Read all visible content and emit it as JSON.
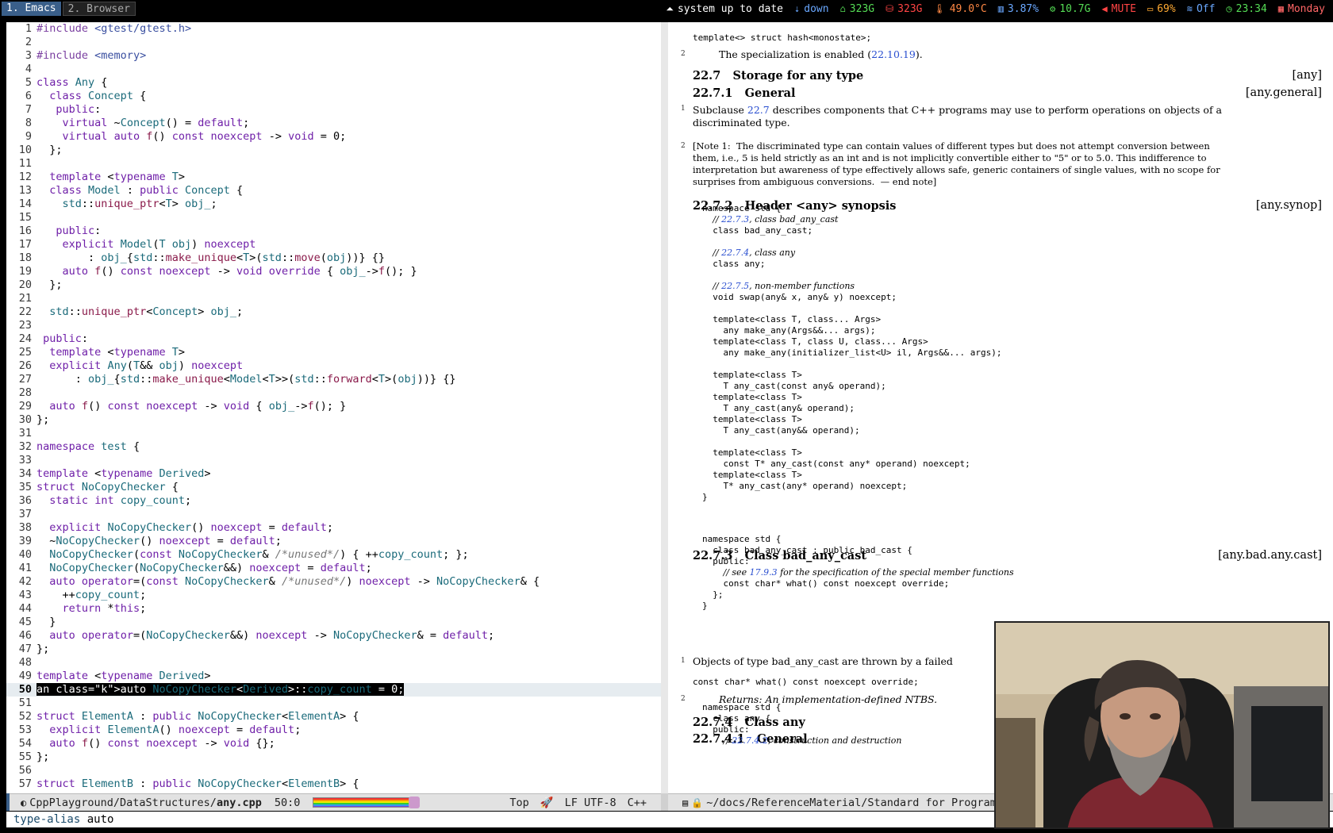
{
  "topbar": {
    "workspaces": [
      {
        "label": "1. Emacs"
      },
      {
        "label": "2. Browser"
      }
    ],
    "status": [
      {
        "icon": "arch-icon",
        "label": "system up to date",
        "color": "#ffffff"
      },
      {
        "icon": "network-icon",
        "label": "down",
        "color": "#6aa8ff"
      },
      {
        "icon": "home-disk-icon",
        "label": "323G",
        "color": "#55dd55"
      },
      {
        "icon": "root-disk-icon",
        "label": "323G",
        "color": "#ff4444"
      },
      {
        "icon": "temperature-icon",
        "label": "49.0°C",
        "color": "#ff8844"
      },
      {
        "icon": "cpu-icon",
        "label": "3.87%",
        "color": "#6aa8ff"
      },
      {
        "icon": "memory-icon",
        "label": "10.7G",
        "color": "#55dd55"
      },
      {
        "icon": "volume-icon",
        "label": "MUTE",
        "color": "#ff4444"
      },
      {
        "icon": "battery-icon",
        "label": "69%",
        "color": "#ffaa33"
      },
      {
        "icon": "wifi-icon",
        "label": "Off",
        "color": "#6aa8ff"
      },
      {
        "icon": "clock-icon",
        "label": "23:34",
        "color": "#55dd55"
      },
      {
        "icon": "calendar-icon",
        "label": "Monday",
        "color": "#ff6666"
      }
    ]
  },
  "editor": {
    "lines": [
      {
        "n": "1",
        "t": "#include <gtest/gtest.h>"
      },
      {
        "n": "2",
        "t": ""
      },
      {
        "n": "3",
        "t": "#include <memory>"
      },
      {
        "n": "4",
        "t": ""
      },
      {
        "n": "5",
        "t": "class Any {"
      },
      {
        "n": "6",
        "t": "  class Concept {"
      },
      {
        "n": "7",
        "t": "   public:"
      },
      {
        "n": "8",
        "t": "    virtual ~Concept() = default;"
      },
      {
        "n": "9",
        "t": "    virtual auto f() const noexcept -> void = 0;"
      },
      {
        "n": "10",
        "t": "  };"
      },
      {
        "n": "11",
        "t": ""
      },
      {
        "n": "12",
        "t": "  template <typename T>"
      },
      {
        "n": "13",
        "t": "  class Model : public Concept {"
      },
      {
        "n": "14",
        "t": "    std::unique_ptr<T> obj_;"
      },
      {
        "n": "15",
        "t": ""
      },
      {
        "n": "16",
        "t": "   public:"
      },
      {
        "n": "17",
        "t": "    explicit Model(T obj) noexcept"
      },
      {
        "n": "18",
        "t": "        : obj_{std::make_unique<T>(std::move(obj))} {}"
      },
      {
        "n": "19",
        "t": "    auto f() const noexcept -> void override { obj_->f(); }"
      },
      {
        "n": "20",
        "t": "  };"
      },
      {
        "n": "21",
        "t": ""
      },
      {
        "n": "22",
        "t": "  std::unique_ptr<Concept> obj_;"
      },
      {
        "n": "23",
        "t": ""
      },
      {
        "n": "24",
        "t": " public:"
      },
      {
        "n": "25",
        "t": "  template <typename T>"
      },
      {
        "n": "26",
        "t": "  explicit Any(T&& obj) noexcept"
      },
      {
        "n": "27",
        "t": "      : obj_{std::make_unique<Model<T>>(std::forward<T>(obj))} {}"
      },
      {
        "n": "28",
        "t": ""
      },
      {
        "n": "29",
        "t": "  auto f() const noexcept -> void { obj_->f(); }"
      },
      {
        "n": "30",
        "t": "};"
      },
      {
        "n": "31",
        "t": ""
      },
      {
        "n": "32",
        "t": "namespace test {"
      },
      {
        "n": "33",
        "t": ""
      },
      {
        "n": "34",
        "t": "template <typename Derived>"
      },
      {
        "n": "35",
        "t": "struct NoCopyChecker {"
      },
      {
        "n": "36",
        "t": "  static int copy_count;"
      },
      {
        "n": "37",
        "t": ""
      },
      {
        "n": "38",
        "t": "  explicit NoCopyChecker() noexcept = default;"
      },
      {
        "n": "39",
        "t": "  ~NoCopyChecker() noexcept = default;"
      },
      {
        "n": "40",
        "t": "  NoCopyChecker(const NoCopyChecker& /*unused*/) { ++copy_count; };"
      },
      {
        "n": "41",
        "t": "  NoCopyChecker(NoCopyChecker&&) noexcept = default;"
      },
      {
        "n": "42",
        "t": "  auto operator=(const NoCopyChecker& /*unused*/) noexcept -> NoCopyChecker& {"
      },
      {
        "n": "43",
        "t": "    ++copy_count;"
      },
      {
        "n": "44",
        "t": "    return *this;"
      },
      {
        "n": "45",
        "t": "  }"
      },
      {
        "n": "46",
        "t": "  auto operator=(NoCopyChecker&&) noexcept -> NoCopyChecker& = default;"
      },
      {
        "n": "47",
        "t": "};"
      },
      {
        "n": "48",
        "t": ""
      },
      {
        "n": "49",
        "t": "template <typename Derived>"
      },
      {
        "n": "50",
        "t": "auto NoCopyChecker<Derived>::copy_count = 0;"
      },
      {
        "n": "51",
        "t": ""
      },
      {
        "n": "52",
        "t": "struct ElementA : public NoCopyChecker<ElementA> {"
      },
      {
        "n": "53",
        "t": "  explicit ElementA() noexcept = default;"
      },
      {
        "n": "54",
        "t": "  auto f() const noexcept -> void {};"
      },
      {
        "n": "55",
        "t": "};"
      },
      {
        "n": "56",
        "t": ""
      },
      {
        "n": "57",
        "t": "struct ElementB : public NoCopyChecker<ElementB> {"
      }
    ],
    "current_line": "50"
  },
  "doc": {
    "top_code": "template<> struct hash<monostate>;",
    "p2_num": "2",
    "p2_text": "The specialization is enabled (",
    "p2_link": "22.10.19",
    "p2_end": ").",
    "s227_num": "22.7",
    "s227_title": "Storage for any type",
    "s227_tag": "[any]",
    "s2271_num": "22.7.1",
    "s2271_title": "General",
    "s2271_tag": "[any.general]",
    "gen1_num": "1",
    "gen1_a": "Subclause ",
    "gen1_link": "22.7",
    "gen1_b": " describes components that C++ programs may use to perform operations on objects of a",
    "gen1_c": "discriminated type.",
    "gen2_num": "2",
    "gen2_l1": "[Note 1:  The discriminated type can contain values of different types but does not attempt conversion between",
    "gen2_l2": "them, i.e., 5 is held strictly as an int and is not implicitly convertible either to \"5\" or to 5.0. This indifference to",
    "gen2_l3": "interpretation but awareness of type effectively allows safe, generic containers of single values, with no scope for",
    "gen2_l4": "surprises from ambiguous conversions.  — end note]",
    "s2272_num": "22.7.2",
    "s2272_title": "Header <any> synopsis",
    "s2272_tag": "[any.synop]",
    "synopsis": [
      "namespace std {",
      "  // 22.7.3, class bad_any_cast",
      "  class bad_any_cast;",
      "",
      "  // 22.7.4, class any",
      "  class any;",
      "",
      "  // 22.7.5, non-member functions",
      "  void swap(any& x, any& y) noexcept;",
      "",
      "  template<class T, class... Args>",
      "    any make_any(Args&&... args);",
      "  template<class T, class U, class... Args>",
      "    any make_any(initializer_list<U> il, Args&&... args);",
      "",
      "  template<class T>",
      "    T any_cast(const any& operand);",
      "  template<class T>",
      "    T any_cast(any& operand);",
      "  template<class T>",
      "    T any_cast(any&& operand);",
      "",
      "  template<class T>",
      "    const T* any_cast(const any* operand) noexcept;",
      "  template<class T>",
      "    T* any_cast(any* operand) noexcept;",
      "}"
    ],
    "s2273_num": "22.7.3",
    "s2273_title": "Class bad_any_cast",
    "s2273_tag": "[any.bad.any.cast]",
    "badcast": [
      "namespace std {",
      "  class bad_any_cast : public bad_cast {",
      "  public:",
      "    // see 17.9.3 for the specification of the special member functions",
      "    const char* what() const noexcept override;",
      "  };",
      "}"
    ],
    "bc1_num": "1",
    "bc1_text": "Objects of type bad_any_cast are thrown by a failed",
    "bc_sig": "const char* what() const noexcept override;",
    "bc2_num": "2",
    "bc2_text": "Returns: An implementation-defined NTBS.",
    "s2274_num": "22.7.4",
    "s2274_title": "Class any",
    "s22741_num": "22.7.4.1",
    "s22741_title": "General",
    "anycode": [
      "namespace std {",
      "  class any {",
      "  public:",
      "    // 22.7.4.2, construction and destruction"
    ]
  },
  "modeline_left": {
    "file_path": "CppPlayground/DataStructures/",
    "file_name": "any.cpp",
    "position": "50:0",
    "scroll": "Top",
    "encoding": "LF UTF-8",
    "mode": "C++"
  },
  "modeline_right": {
    "path": "~/docs/ReferenceMaterial/Standard for Program"
  },
  "minibuffer": {
    "keyword": "type-alias",
    "value": "auto"
  }
}
